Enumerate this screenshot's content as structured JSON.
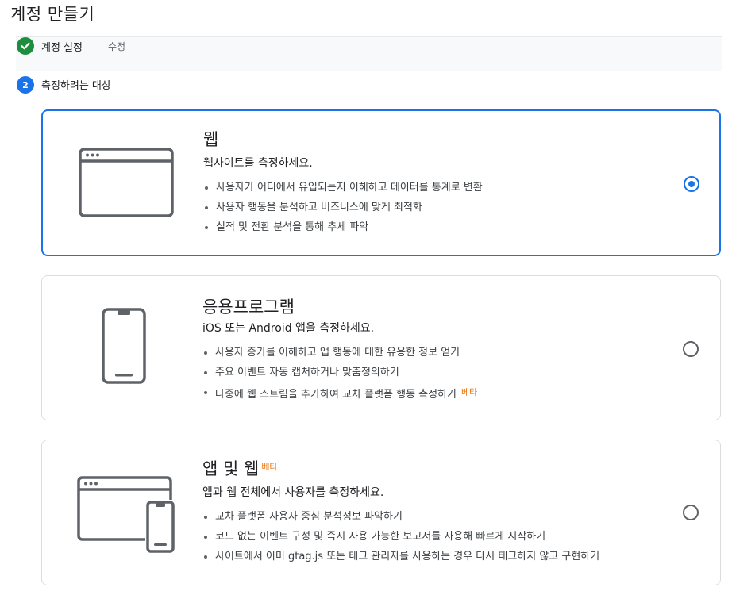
{
  "page": {
    "title": "계정 만들기"
  },
  "steps": [
    {
      "number": "1",
      "label": "계정 설정",
      "edit_label": "수정",
      "status": "complete"
    },
    {
      "number": "2",
      "label": "측정하려는 대상",
      "status": "active"
    }
  ],
  "options": [
    {
      "id": "web",
      "title": "웹",
      "subtitle": "웹사이트를 측정하세요.",
      "bullets": [
        "사용자가 어디에서 유입되는지 이해하고 데이터를 통계로 변환",
        "사용자 행동을 분석하고 비즈니스에 맞게 최적화",
        "실적 및 전환 분석을 통해 추세 파악"
      ],
      "icon": "browser-window-icon",
      "selected": true
    },
    {
      "id": "app",
      "title": "응용프로그램",
      "subtitle": "iOS 또는 Android 앱을 측정하세요.",
      "bullets": [
        "사용자 증가를 이해하고 앱 행동에 대한 유용한 정보 얻기",
        "주요 이벤트 자동 캡처하거나 맞춤정의하기",
        "나중에 웹 스트림을 추가하여 교차 플랫폼 행동 측정하기"
      ],
      "bullet_badge": "베타",
      "icon": "smartphone-icon",
      "selected": false
    },
    {
      "id": "app-web",
      "title": "앱 및 웹",
      "title_badge": "베타",
      "subtitle": "앱과 웹 전체에서 사용자를 측정하세요.",
      "bullets": [
        "교차 플랫폼 사용자 중심 분석정보 파악하기",
        "코드 없는 이벤트 구성 및 즉시 사용 가능한 보고서를 사용해 빠르게 시작하기",
        "사이트에서 이미 gtag.js 또는 태그 관리자를 사용하는 경우 다시 태그하지 않고 구현하기"
      ],
      "icon": "browser-and-phone-icon",
      "selected": false
    }
  ],
  "colors": {
    "accent": "#1a73e8",
    "success": "#1e8e3e",
    "badge": "#e8710a",
    "border": "#dadce0"
  }
}
